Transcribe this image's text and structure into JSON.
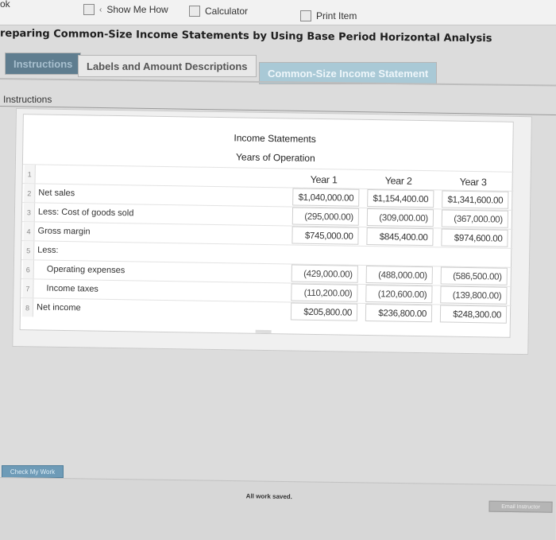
{
  "toolbar": {
    "fragment_left": "ok",
    "show_me_how": "Show Me How",
    "calculator": "Calculator",
    "print_item": "Print Item"
  },
  "page_title": "reparing Common-Size Income Statements by Using Base Period Horizontal Analysis",
  "tabs": [
    {
      "label": "Instructions",
      "active": true
    },
    {
      "label": "Labels and Amount Descriptions",
      "active": false
    },
    {
      "label": "Common-Size Income Statement",
      "active": false
    }
  ],
  "section_label": "Instructions",
  "statement": {
    "heading1": "Income Statements",
    "heading2": "Years of Operation",
    "year_headers": [
      "Year 1",
      "Year 2",
      "Year 3"
    ],
    "rows": [
      {
        "num": "1",
        "label": "",
        "values": [
          "",
          "",
          ""
        ]
      },
      {
        "num": "2",
        "label": "Net sales",
        "values": [
          "$1,040,000.00",
          "$1,154,400.00",
          "$1,341,600.00"
        ]
      },
      {
        "num": "3",
        "label": "Less: Cost of goods sold",
        "values": [
          "(295,000.00)",
          "(309,000.00)",
          "(367,000.00)"
        ]
      },
      {
        "num": "4",
        "label": "Gross margin",
        "values": [
          "$745,000.00",
          "$845,400.00",
          "$974,600.00"
        ]
      },
      {
        "num": "5",
        "label": "Less:",
        "values": [
          "",
          "",
          ""
        ]
      },
      {
        "num": "6",
        "label": "Operating expenses",
        "values": [
          "(429,000.00)",
          "(488,000.00)",
          "(586,500.00)"
        ]
      },
      {
        "num": "7",
        "label": "Income taxes",
        "values": [
          "(110,200.00)",
          "(120,600.00)",
          "(139,800.00)"
        ]
      },
      {
        "num": "8",
        "label": "Net income",
        "values": [
          "$205,800.00",
          "$236,800.00",
          "$248,300.00"
        ]
      }
    ]
  },
  "check_my_work": "Check My Work",
  "saved_status": "All work saved.",
  "email_instructor": "Email Instructor"
}
